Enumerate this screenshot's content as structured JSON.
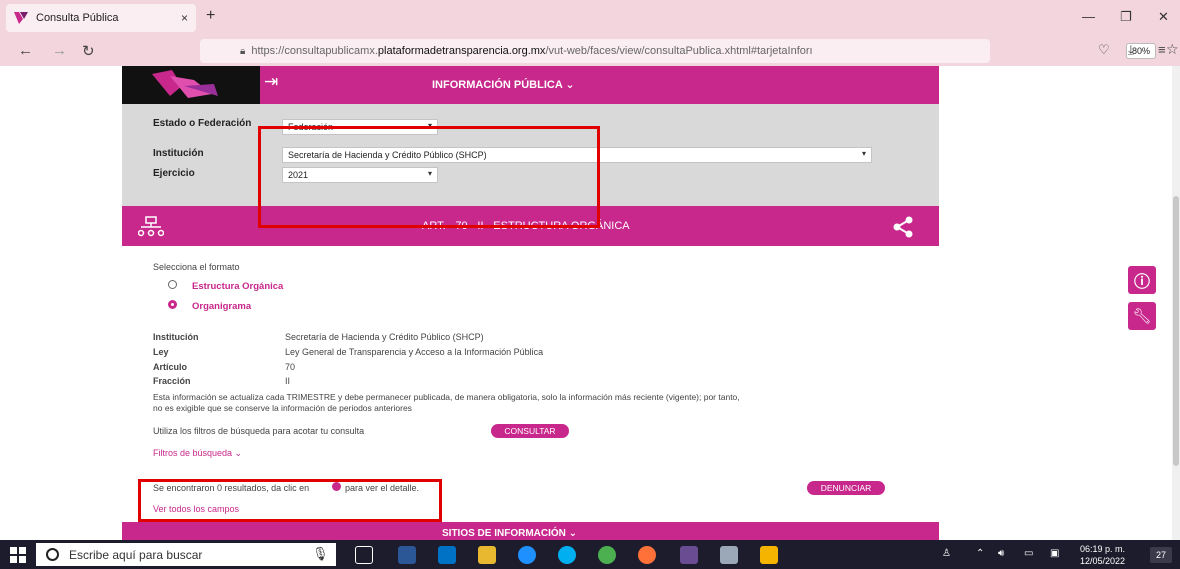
{
  "browser": {
    "tab_title": "Consulta Pública",
    "tab_close": "×",
    "new_tab": "+",
    "url_pre": "https://consultapublicamx.",
    "url_host": "plataformadetransparencia.org.mx",
    "url_post": "/vut-web/faces/view/consultaPublica.xhtml#tarjetaInforı",
    "zoom": "80%",
    "window_min": "—",
    "window_max": "❐",
    "window_close": "✕"
  },
  "header": {
    "title": "INFORMACIÓN PÚBLICA ⌄"
  },
  "filters": {
    "estado_label": "Estado o Federación",
    "estado_value": "Federación",
    "institucion_label": "Institución",
    "institucion_value": "Secretaría de Hacienda y Crédito Público (SHCP)",
    "ejercicio_label": "Ejercicio",
    "ejercicio_value": "2021"
  },
  "section": {
    "title": "ART. - 70 - II - ESTRUCTURA ORGÁNICA"
  },
  "format": {
    "prompt": "Selecciona el formato",
    "option1": "Estructura Orgánica",
    "option2": "Organigrama",
    "selected": "Organigrama"
  },
  "meta": {
    "institucion_label": "Institución",
    "institucion_value": "Secretaría de Hacienda y Crédito Público (SHCP)",
    "ley_label": "Ley",
    "ley_value": "Ley General de Transparencia y Acceso a la Información Pública",
    "articulo_label": "Artículo",
    "articulo_value": "70",
    "fraccion_label": "Fracción",
    "fraccion_value": "II"
  },
  "notice": {
    "line1": "Esta información se actualiza cada TRIMESTRE y debe permanecer publicada, de manera obligatoria, solo la información más reciente (vigente); por tanto,",
    "line2": "no es exigible que se conserve la información de periodos anteriores"
  },
  "search": {
    "hint": "Utiliza los filtros de búsqueda para acotar tu consulta",
    "consultar": "CONSULTAR",
    "filtros": "Filtros de búsqueda ⌄"
  },
  "results": {
    "found": "Se encontraron 0 resultados, da clic en",
    "found_tail": "para ver el detalle.",
    "denunciar": "DENUNCIAR",
    "ver_todos": "Ver todos los campos"
  },
  "footer": {
    "title": "SITIOS DE INFORMACIÓN ⌄"
  },
  "taskbar": {
    "search_placeholder": "Escribe aquí para buscar",
    "time": "06:19 p. m.",
    "date": "12/05/2022",
    "notifications": "27"
  },
  "colors": {
    "brand": "#c8278b",
    "highlight": "#e00000"
  }
}
